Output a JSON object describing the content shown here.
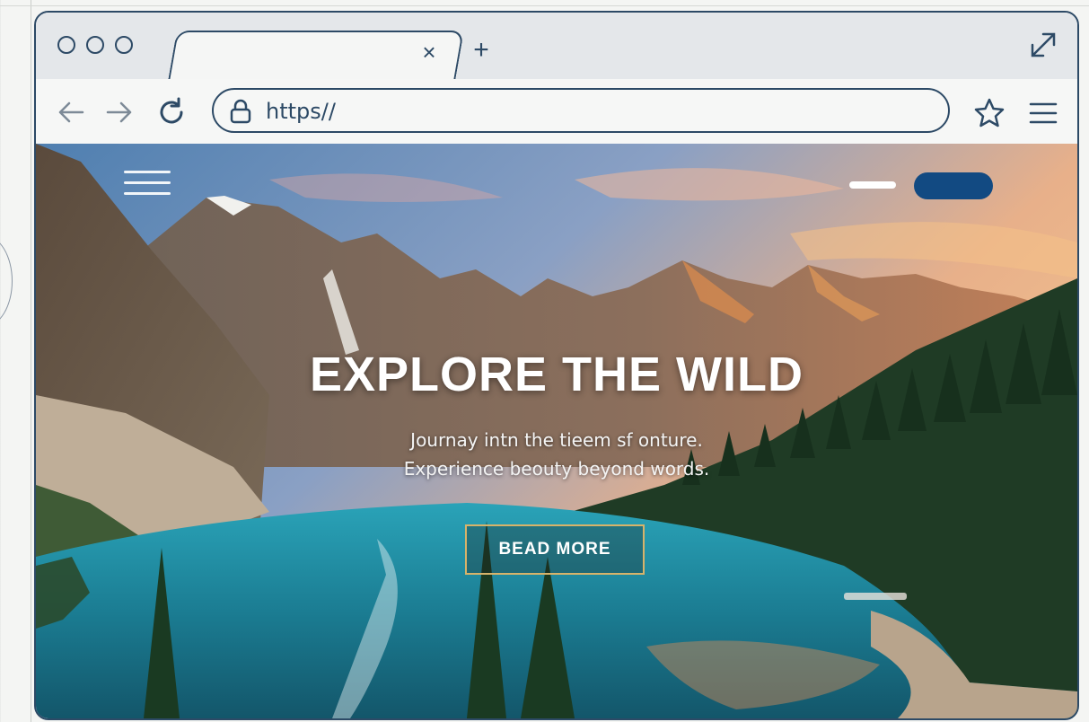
{
  "browser": {
    "tab": {
      "close_glyph": "×",
      "new_glyph": "+"
    },
    "toolbar": {
      "url": "https//"
    },
    "icons": {
      "window_controls": [
        "dot-icon",
        "dot-icon",
        "dot-icon"
      ],
      "expand": "expand-icon",
      "back": "arrow-left-icon",
      "forward": "arrow-right-icon",
      "reload": "reload-icon",
      "lock": "lock-icon",
      "bookmark": "star-icon",
      "menu": "hamburger-menu-icon"
    }
  },
  "page": {
    "hero": {
      "title": "EXPLORE THE WILD",
      "subtitle_line1": "Journay intn the tieem sf onture.",
      "subtitle_line2": "Experience beouty beyond words.",
      "cta_label": "BEAD MORE"
    },
    "nav": {
      "menu_icon": "hamburger-icon"
    }
  },
  "colors": {
    "frame": "#2d4a66",
    "accent_button": "#124a82",
    "cta_border": "#d7b36a",
    "lake": "#1f8fa3",
    "forest": "#1e3a24"
  }
}
